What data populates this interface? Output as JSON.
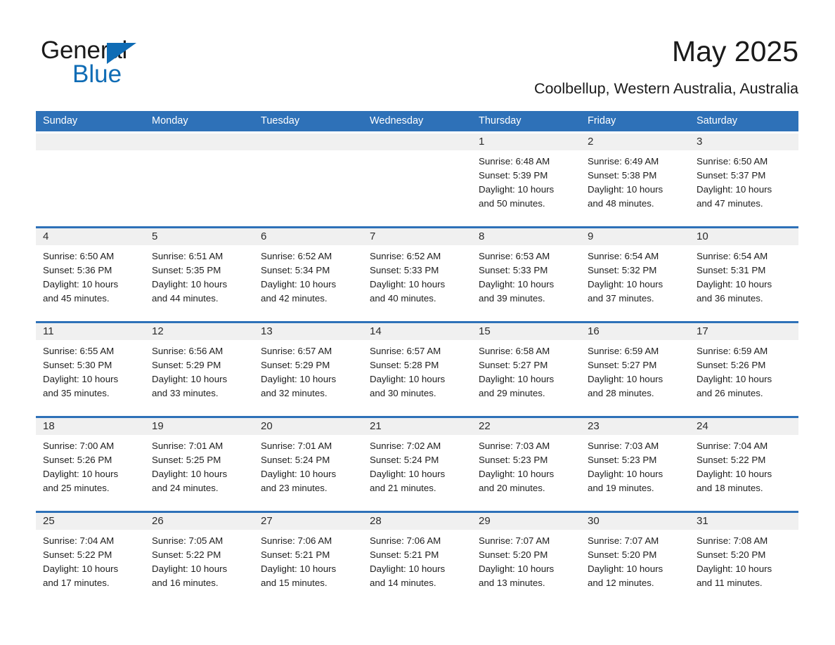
{
  "brand": {
    "name_part1": "General",
    "name_part2": "Blue",
    "triangle_color": "#0f6cb5"
  },
  "header": {
    "month_year": "May 2025",
    "location": "Coolbellup, Western Australia, Australia"
  },
  "colors": {
    "header_blue": "#2e71b8",
    "date_band_gray": "#f0f0f0",
    "text": "#1d1d1d"
  },
  "weekdays": [
    "Sunday",
    "Monday",
    "Tuesday",
    "Wednesday",
    "Thursday",
    "Friday",
    "Saturday"
  ],
  "weeks": [
    [
      {
        "day": "",
        "empty": true,
        "sunrise": "",
        "sunset": "",
        "daylight1": "",
        "daylight2": ""
      },
      {
        "day": "",
        "empty": true,
        "sunrise": "",
        "sunset": "",
        "daylight1": "",
        "daylight2": ""
      },
      {
        "day": "",
        "empty": true,
        "sunrise": "",
        "sunset": "",
        "daylight1": "",
        "daylight2": ""
      },
      {
        "day": "",
        "empty": true,
        "sunrise": "",
        "sunset": "",
        "daylight1": "",
        "daylight2": ""
      },
      {
        "day": "1",
        "sunrise": "Sunrise: 6:48 AM",
        "sunset": "Sunset: 5:39 PM",
        "daylight1": "Daylight: 10 hours",
        "daylight2": "and 50 minutes."
      },
      {
        "day": "2",
        "sunrise": "Sunrise: 6:49 AM",
        "sunset": "Sunset: 5:38 PM",
        "daylight1": "Daylight: 10 hours",
        "daylight2": "and 48 minutes."
      },
      {
        "day": "3",
        "sunrise": "Sunrise: 6:50 AM",
        "sunset": "Sunset: 5:37 PM",
        "daylight1": "Daylight: 10 hours",
        "daylight2": "and 47 minutes."
      }
    ],
    [
      {
        "day": "4",
        "sunrise": "Sunrise: 6:50 AM",
        "sunset": "Sunset: 5:36 PM",
        "daylight1": "Daylight: 10 hours",
        "daylight2": "and 45 minutes."
      },
      {
        "day": "5",
        "sunrise": "Sunrise: 6:51 AM",
        "sunset": "Sunset: 5:35 PM",
        "daylight1": "Daylight: 10 hours",
        "daylight2": "and 44 minutes."
      },
      {
        "day": "6",
        "sunrise": "Sunrise: 6:52 AM",
        "sunset": "Sunset: 5:34 PM",
        "daylight1": "Daylight: 10 hours",
        "daylight2": "and 42 minutes."
      },
      {
        "day": "7",
        "sunrise": "Sunrise: 6:52 AM",
        "sunset": "Sunset: 5:33 PM",
        "daylight1": "Daylight: 10 hours",
        "daylight2": "and 40 minutes."
      },
      {
        "day": "8",
        "sunrise": "Sunrise: 6:53 AM",
        "sunset": "Sunset: 5:33 PM",
        "daylight1": "Daylight: 10 hours",
        "daylight2": "and 39 minutes."
      },
      {
        "day": "9",
        "sunrise": "Sunrise: 6:54 AM",
        "sunset": "Sunset: 5:32 PM",
        "daylight1": "Daylight: 10 hours",
        "daylight2": "and 37 minutes."
      },
      {
        "day": "10",
        "sunrise": "Sunrise: 6:54 AM",
        "sunset": "Sunset: 5:31 PM",
        "daylight1": "Daylight: 10 hours",
        "daylight2": "and 36 minutes."
      }
    ],
    [
      {
        "day": "11",
        "sunrise": "Sunrise: 6:55 AM",
        "sunset": "Sunset: 5:30 PM",
        "daylight1": "Daylight: 10 hours",
        "daylight2": "and 35 minutes."
      },
      {
        "day": "12",
        "sunrise": "Sunrise: 6:56 AM",
        "sunset": "Sunset: 5:29 PM",
        "daylight1": "Daylight: 10 hours",
        "daylight2": "and 33 minutes."
      },
      {
        "day": "13",
        "sunrise": "Sunrise: 6:57 AM",
        "sunset": "Sunset: 5:29 PM",
        "daylight1": "Daylight: 10 hours",
        "daylight2": "and 32 minutes."
      },
      {
        "day": "14",
        "sunrise": "Sunrise: 6:57 AM",
        "sunset": "Sunset: 5:28 PM",
        "daylight1": "Daylight: 10 hours",
        "daylight2": "and 30 minutes."
      },
      {
        "day": "15",
        "sunrise": "Sunrise: 6:58 AM",
        "sunset": "Sunset: 5:27 PM",
        "daylight1": "Daylight: 10 hours",
        "daylight2": "and 29 minutes."
      },
      {
        "day": "16",
        "sunrise": "Sunrise: 6:59 AM",
        "sunset": "Sunset: 5:27 PM",
        "daylight1": "Daylight: 10 hours",
        "daylight2": "and 28 minutes."
      },
      {
        "day": "17",
        "sunrise": "Sunrise: 6:59 AM",
        "sunset": "Sunset: 5:26 PM",
        "daylight1": "Daylight: 10 hours",
        "daylight2": "and 26 minutes."
      }
    ],
    [
      {
        "day": "18",
        "sunrise": "Sunrise: 7:00 AM",
        "sunset": "Sunset: 5:26 PM",
        "daylight1": "Daylight: 10 hours",
        "daylight2": "and 25 minutes."
      },
      {
        "day": "19",
        "sunrise": "Sunrise: 7:01 AM",
        "sunset": "Sunset: 5:25 PM",
        "daylight1": "Daylight: 10 hours",
        "daylight2": "and 24 minutes."
      },
      {
        "day": "20",
        "sunrise": "Sunrise: 7:01 AM",
        "sunset": "Sunset: 5:24 PM",
        "daylight1": "Daylight: 10 hours",
        "daylight2": "and 23 minutes."
      },
      {
        "day": "21",
        "sunrise": "Sunrise: 7:02 AM",
        "sunset": "Sunset: 5:24 PM",
        "daylight1": "Daylight: 10 hours",
        "daylight2": "and 21 minutes."
      },
      {
        "day": "22",
        "sunrise": "Sunrise: 7:03 AM",
        "sunset": "Sunset: 5:23 PM",
        "daylight1": "Daylight: 10 hours",
        "daylight2": "and 20 minutes."
      },
      {
        "day": "23",
        "sunrise": "Sunrise: 7:03 AM",
        "sunset": "Sunset: 5:23 PM",
        "daylight1": "Daylight: 10 hours",
        "daylight2": "and 19 minutes."
      },
      {
        "day": "24",
        "sunrise": "Sunrise: 7:04 AM",
        "sunset": "Sunset: 5:22 PM",
        "daylight1": "Daylight: 10 hours",
        "daylight2": "and 18 minutes."
      }
    ],
    [
      {
        "day": "25",
        "sunrise": "Sunrise: 7:04 AM",
        "sunset": "Sunset: 5:22 PM",
        "daylight1": "Daylight: 10 hours",
        "daylight2": "and 17 minutes."
      },
      {
        "day": "26",
        "sunrise": "Sunrise: 7:05 AM",
        "sunset": "Sunset: 5:22 PM",
        "daylight1": "Daylight: 10 hours",
        "daylight2": "and 16 minutes."
      },
      {
        "day": "27",
        "sunrise": "Sunrise: 7:06 AM",
        "sunset": "Sunset: 5:21 PM",
        "daylight1": "Daylight: 10 hours",
        "daylight2": "and 15 minutes."
      },
      {
        "day": "28",
        "sunrise": "Sunrise: 7:06 AM",
        "sunset": "Sunset: 5:21 PM",
        "daylight1": "Daylight: 10 hours",
        "daylight2": "and 14 minutes."
      },
      {
        "day": "29",
        "sunrise": "Sunrise: 7:07 AM",
        "sunset": "Sunset: 5:20 PM",
        "daylight1": "Daylight: 10 hours",
        "daylight2": "and 13 minutes."
      },
      {
        "day": "30",
        "sunrise": "Sunrise: 7:07 AM",
        "sunset": "Sunset: 5:20 PM",
        "daylight1": "Daylight: 10 hours",
        "daylight2": "and 12 minutes."
      },
      {
        "day": "31",
        "sunrise": "Sunrise: 7:08 AM",
        "sunset": "Sunset: 5:20 PM",
        "daylight1": "Daylight: 10 hours",
        "daylight2": "and 11 minutes."
      }
    ]
  ]
}
